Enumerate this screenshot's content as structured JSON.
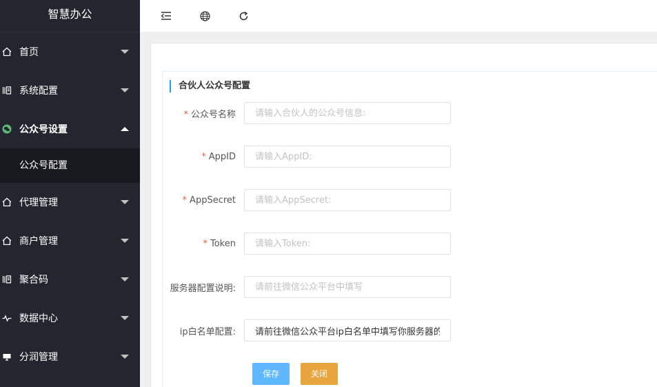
{
  "sidebar": {
    "brand": "智慧办公",
    "items": [
      {
        "label": "首页",
        "icon": "home-icon"
      },
      {
        "label": "系统配置",
        "icon": "book-icon"
      },
      {
        "label": "公众号设置",
        "icon": "wechat-icon"
      },
      {
        "label": "代理管理",
        "icon": "home-icon"
      },
      {
        "label": "商户管理",
        "icon": "home-icon"
      },
      {
        "label": "聚合码",
        "icon": "book-icon"
      },
      {
        "label": "数据中心",
        "icon": "pulse-icon"
      },
      {
        "label": "分润管理",
        "icon": "monitor-icon"
      }
    ],
    "sub_item": "公众号配置"
  },
  "topbar": {
    "buttons": [
      "menu-collapse-icon",
      "globe-icon",
      "refresh-icon"
    ]
  },
  "form": {
    "title": "合伙人公众号配置",
    "fields": [
      {
        "label": "公众号名称",
        "required": true,
        "value": "",
        "placeholder": "请输入合伙人的公众号信息:"
      },
      {
        "label": "AppID",
        "required": true,
        "value": "",
        "placeholder": "请输入AppID:"
      },
      {
        "label": "AppSecret",
        "required": true,
        "value": "",
        "placeholder": "请输入AppSecret:"
      },
      {
        "label": "Token",
        "required": true,
        "value": "",
        "placeholder": "请输入Token:"
      },
      {
        "label": "服务器配置说明:",
        "required": false,
        "value": "",
        "placeholder": "请前往微信公众平台中填写"
      },
      {
        "label": "ip白名单配置:",
        "required": false,
        "value": "请前往微信公众平台ip白名单中填写你服务器的",
        "placeholder": ""
      }
    ],
    "save_label": "保存",
    "close_label": "关闭"
  },
  "colors": {
    "sidebar_bg": "#23262e",
    "submenu_bg": "#181a1f",
    "save_button": "#5fb8ff",
    "close_button": "#e8a53d",
    "required_star": "#ff5722",
    "wechat_green": "#5fb878"
  }
}
